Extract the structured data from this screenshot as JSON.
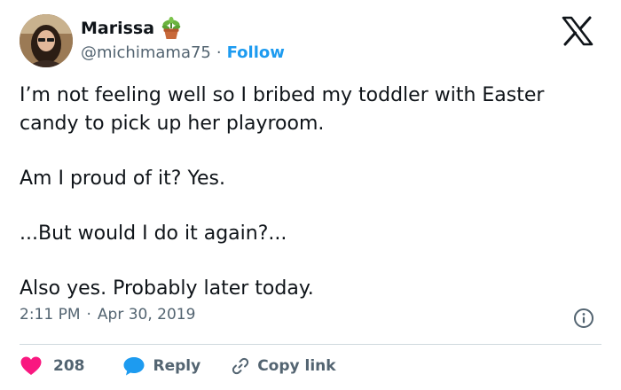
{
  "author": {
    "name": "Marissa",
    "handle": "@michimama75",
    "separator": "·",
    "follow_label": "Follow"
  },
  "tweet": {
    "paragraphs": [
      "I’m not feeling well so I bribed my toddler with Easter candy to pick up her playroom.",
      "Am I proud of it? Yes.",
      "...But would I do it again?...",
      "Also yes. Probably later today."
    ],
    "time": "2:11 PM",
    "meta_separator": "·",
    "date": "Apr 30, 2019"
  },
  "actions": {
    "like_count": "208",
    "reply_label": "Reply",
    "copy_link_label": "Copy link"
  },
  "colors": {
    "accent": "#1d9bf0",
    "like": "#f91880",
    "text": "#0f1419",
    "muted": "#536471",
    "divider": "#cfd9de"
  },
  "icons": [
    "plant-emoji-icon",
    "x-logo-icon",
    "info-icon",
    "heart-icon",
    "reply-bubble-icon",
    "link-icon"
  ]
}
